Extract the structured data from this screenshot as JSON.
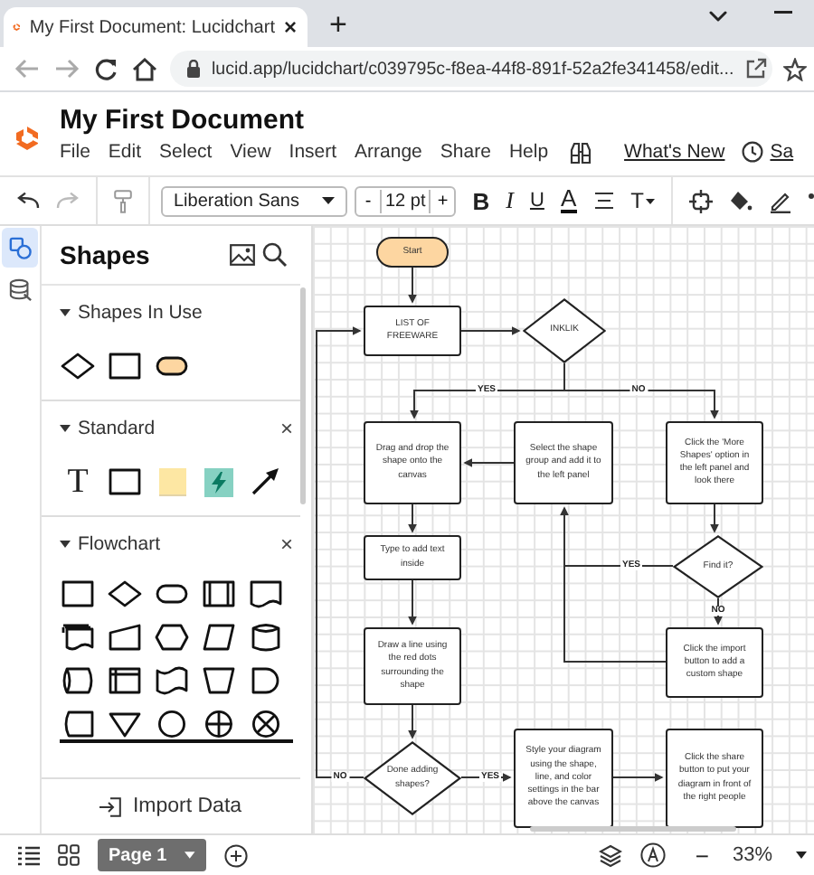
{
  "browser": {
    "tab": {
      "title": "My First Document: Lucidchart",
      "close": "×",
      "selected": true
    },
    "new_tab": "+",
    "url": "lucid.app/lucidchart/c039795c-f8ea-44f8-891f-52a2fe341458/edit..."
  },
  "app": {
    "title": "My First Document",
    "menu": [
      "File",
      "Edit",
      "Select",
      "View",
      "Insert",
      "Arrange",
      "Share",
      "Help"
    ],
    "whats_new": "What's New",
    "cut_label": "Sa"
  },
  "toolbar": {
    "font": "Liberation Sans",
    "size_minus": "-",
    "font_size": "12 pt",
    "size_plus": "+",
    "format": [
      {
        "kind": "bold",
        "label": "B"
      },
      {
        "kind": "italic",
        "label": "I"
      },
      {
        "kind": "underline",
        "label": "U"
      },
      {
        "kind": "color",
        "label": "A"
      }
    ],
    "text_options": "T"
  },
  "rail": [
    {
      "kind": "shapes",
      "selected": true
    },
    {
      "kind": "data",
      "selected": false
    }
  ],
  "shapes_panel": {
    "title": "Shapes",
    "sections": [
      {
        "title": "Shapes In Use",
        "expanded": true,
        "shapes": [
          {
            "kind": "decision"
          },
          {
            "kind": "process"
          },
          {
            "kind": "terminator"
          }
        ]
      },
      {
        "title": "Standard",
        "expanded": true,
        "close": "×",
        "shapes": [
          {
            "kind": "text",
            "label": "T"
          },
          {
            "kind": "process"
          },
          {
            "kind": "note"
          },
          {
            "kind": "lightning"
          },
          {
            "kind": "arrow"
          }
        ]
      },
      {
        "title": "Flowchart",
        "expanded": true,
        "close": "×",
        "shapes": [
          {
            "kind": "process"
          },
          {
            "kind": "decision"
          },
          {
            "kind": "terminator"
          },
          {
            "kind": "predefined"
          },
          {
            "kind": "document"
          },
          {
            "kind": "multidoc"
          },
          {
            "kind": "manual_input"
          },
          {
            "kind": "preparation"
          },
          {
            "kind": "data"
          },
          {
            "kind": "database"
          },
          {
            "kind": "direct_data"
          },
          {
            "kind": "internal_storage"
          },
          {
            "kind": "tape"
          },
          {
            "kind": "manual_op"
          },
          {
            "kind": "delay"
          },
          {
            "kind": "stored_data"
          },
          {
            "kind": "merge"
          },
          {
            "kind": "connector"
          },
          {
            "kind": "or"
          },
          {
            "kind": "summing"
          }
        ]
      }
    ],
    "import": "Import Data"
  },
  "canvas": {
    "nodes": [
      {
        "kind": "terminator",
        "text": "Start"
      },
      {
        "kind": "process",
        "text": "LIST OF FREEWARE"
      },
      {
        "kind": "decision",
        "text": "INKLIK"
      },
      {
        "kind": "process",
        "text": "Drag and drop the shape onto the canvas"
      },
      {
        "kind": "process",
        "text": "Select the shape group and add it to the left panel"
      },
      {
        "kind": "process",
        "text": "Click the 'More Shapes' option in the left panel and look there"
      },
      {
        "kind": "process",
        "text": "Type to add text inside"
      },
      {
        "kind": "decision",
        "text": "Find it?"
      },
      {
        "kind": "process",
        "text": "Draw a line using the red dots surrounding the shape"
      },
      {
        "kind": "process",
        "text": "Click the import button to add a custom shape"
      },
      {
        "kind": "decision",
        "text": "Done adding shapes?"
      },
      {
        "kind": "process",
        "text": "Style your diagram using the shape, line, and color settings in the bar above the canvas"
      },
      {
        "kind": "process",
        "text": "Click the share button to put your diagram in front of the right people"
      }
    ],
    "labels": [
      "YES",
      "NO",
      "YES",
      "NO",
      "NO",
      "YES"
    ]
  },
  "bottom_bar": {
    "page": "Page 1",
    "zoom_minus": "−",
    "zoom": "33%"
  }
}
